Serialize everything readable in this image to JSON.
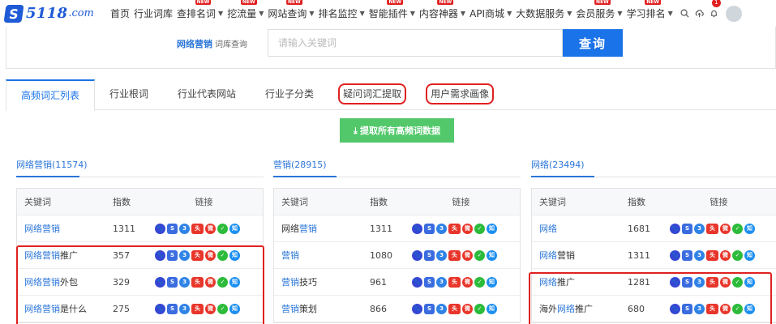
{
  "nav": {
    "logo_number": "5118",
    "logo_domain": ".com",
    "items": [
      {
        "label": "首页",
        "caret": false,
        "new": false
      },
      {
        "label": "行业词库",
        "caret": false,
        "new": false
      },
      {
        "label": "查排名词",
        "caret": true,
        "new": true
      },
      {
        "label": "挖流量",
        "caret": true,
        "new": true
      },
      {
        "label": "网站查询",
        "caret": true,
        "new": true
      },
      {
        "label": "排名监控",
        "caret": true,
        "new": false
      },
      {
        "label": "智能插件",
        "caret": true,
        "new": true
      },
      {
        "label": "内容神器",
        "caret": true,
        "new": true
      },
      {
        "label": "API商城",
        "caret": true,
        "new": false
      },
      {
        "label": "大数据服务",
        "caret": true,
        "new": false
      },
      {
        "label": "会员服务",
        "caret": true,
        "new": true
      },
      {
        "label": "学习排名",
        "caret": true,
        "new": true
      }
    ],
    "new_badge": "NEW",
    "bell_count": "1"
  },
  "search": {
    "label": "网络营销",
    "label_sub": "词库查询",
    "placeholder": "请输入关键词",
    "button": "查询"
  },
  "tabs": [
    {
      "label": "高频词汇列表",
      "active": true,
      "highlight": false
    },
    {
      "label": "行业根词",
      "active": false,
      "highlight": false
    },
    {
      "label": "行业代表网站",
      "active": false,
      "highlight": false
    },
    {
      "label": "行业子分类",
      "active": false,
      "highlight": false
    },
    {
      "label": "疑问词汇提取",
      "active": false,
      "highlight": true
    },
    {
      "label": "用户需求画像",
      "active": false,
      "highlight": true
    }
  ],
  "extract_button": "提取所有高频词数据",
  "table_headers": {
    "keyword": "关键词",
    "index": "指数",
    "links": "链接"
  },
  "link_icons": [
    "baidu-icon",
    "sogou-icon",
    "so360-icon",
    "toutiao-icon",
    "weibo-icon",
    "wechat-icon",
    "zhihu-icon"
  ],
  "columns": [
    {
      "title": "网络营销(11574)",
      "rows": [
        {
          "kw_blue": "网络营销",
          "kw_rest": "",
          "index": "1311"
        },
        {
          "kw_blue": "网络营销",
          "kw_rest": "推广",
          "index": "357"
        },
        {
          "kw_blue": "网络营销",
          "kw_rest": "外包",
          "index": "329"
        },
        {
          "kw_blue": "网络营销",
          "kw_rest": "是什么",
          "index": "275"
        }
      ]
    },
    {
      "title": "营销(28915)",
      "rows": [
        {
          "kw_pre": "网络",
          "kw_blue": "营销",
          "kw_rest": "",
          "index": "1311"
        },
        {
          "kw_pre": "",
          "kw_blue": "营销",
          "kw_rest": "",
          "index": "1080"
        },
        {
          "kw_pre": "",
          "kw_blue": "营销",
          "kw_rest": "技巧",
          "index": "961"
        },
        {
          "kw_pre": "",
          "kw_blue": "营销",
          "kw_rest": "策划",
          "index": "866"
        }
      ]
    },
    {
      "title": "网络(23494)",
      "rows": [
        {
          "kw_pre": "",
          "kw_blue": "网络",
          "kw_rest": "",
          "index": "1681"
        },
        {
          "kw_pre": "",
          "kw_blue": "网络",
          "kw_rest": "营销",
          "index": "1311"
        },
        {
          "kw_pre": "",
          "kw_blue": "网络",
          "kw_rest": "推广",
          "index": "1281"
        },
        {
          "kw_pre": "海外",
          "kw_blue": "网络",
          "kw_rest": "推广",
          "index": "680"
        }
      ]
    }
  ],
  "colors": {
    "accent": "#1a73e8",
    "green": "#52c86a",
    "highlight": "#e02020"
  }
}
